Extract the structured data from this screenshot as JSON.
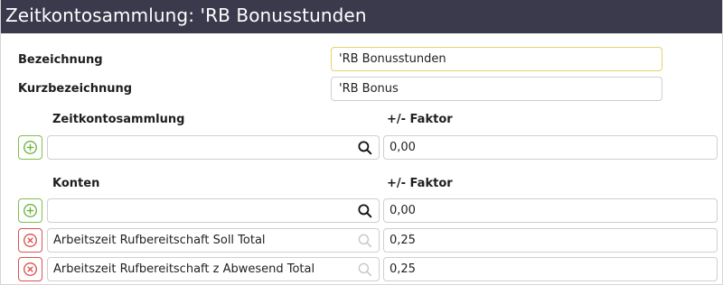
{
  "window": {
    "title": "Zeitkontosammlung: 'RB Bonusstunden"
  },
  "form": {
    "bezeichnung_label": "Bezeichnung",
    "bezeichnung_value": "'RB Bonusstunden",
    "kurzbezeichnung_label": "Kurzbezeichnung",
    "kurzbezeichnung_value": "'RB Bonus"
  },
  "zeitkontosammlung_section": {
    "header_label": "Zeitkontosammlung",
    "factor_header": "+/- Faktor",
    "rows": [
      {
        "value": "",
        "factor": "0,00",
        "type": "add"
      }
    ]
  },
  "konten_section": {
    "header_label": "Konten",
    "factor_header": "+/- Faktor",
    "rows": [
      {
        "value": "",
        "factor": "0,00",
        "type": "add"
      },
      {
        "value": "Arbeitszeit Rufbereitschaft Soll Total",
        "factor": "0,25",
        "type": "remove"
      },
      {
        "value": "Arbeitszeit Rufbereitschaft z Abwesend Total",
        "factor": "0,25",
        "type": "remove"
      }
    ]
  },
  "colors": {
    "titlebar_bg": "#3b3a4c",
    "add_accent": "#6cb33f",
    "remove_accent": "#d9534f",
    "focus_border": "#e5d36a"
  },
  "icons": {
    "add": "plus-circle-icon",
    "remove": "x-circle-icon",
    "search": "search-icon"
  }
}
